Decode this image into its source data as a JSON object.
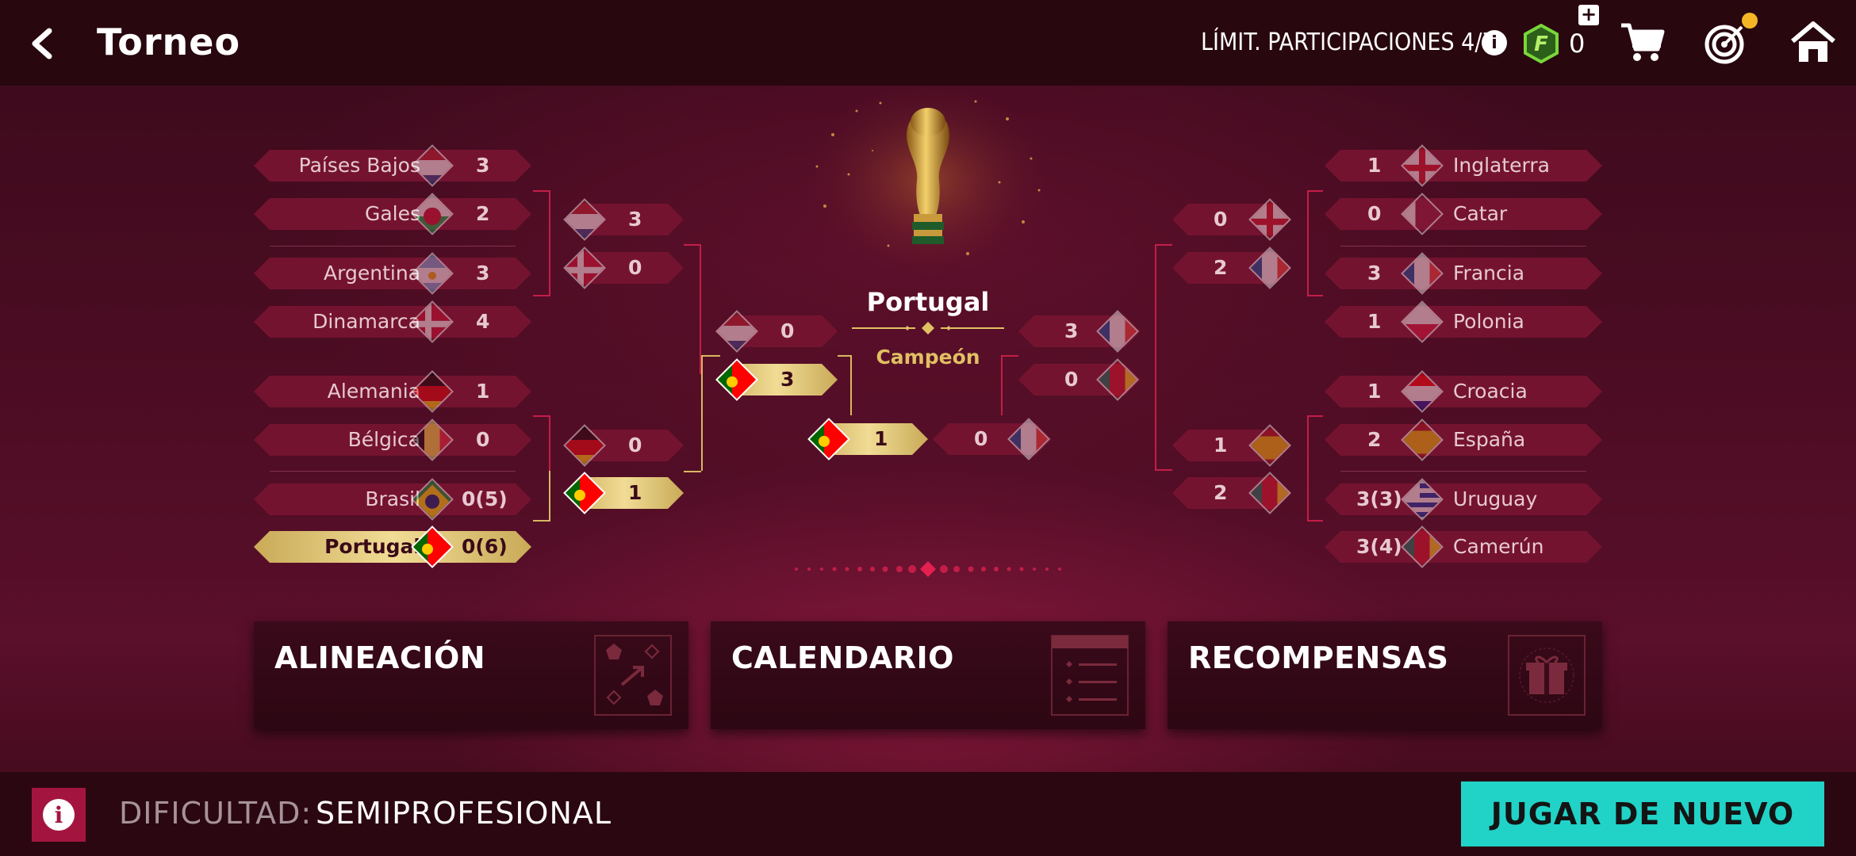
{
  "header": {
    "title": "Torneo",
    "limit_text": "LÍMIT. PARTICIPACIONES 4/7",
    "info": "i",
    "coins": "0",
    "coin_letter": "F",
    "plus": "+"
  },
  "bracket": {
    "left_r16": [
      {
        "team": "Países Bajos",
        "score": "3"
      },
      {
        "team": "Gales",
        "score": "2"
      },
      {
        "team": "Argentina",
        "score": "3"
      },
      {
        "team": "Dinamarca",
        "score": "4"
      },
      {
        "team": "Alemania",
        "score": "1"
      },
      {
        "team": "Bélgica",
        "score": "0"
      },
      {
        "team": "Brasil",
        "score": "0(5)"
      },
      {
        "team": "Portugal",
        "score": "0(6)"
      }
    ],
    "left_qf": [
      "3",
      "0",
      "0",
      "1"
    ],
    "left_sf": [
      "0",
      "3"
    ],
    "final": {
      "left": "1",
      "right": "0"
    },
    "right_sf": [
      "3",
      "0"
    ],
    "right_qf": [
      "0",
      "2",
      "1",
      "2"
    ],
    "right_r16": [
      {
        "team": "Inglaterra",
        "score": "1"
      },
      {
        "team": "Catar",
        "score": "0"
      },
      {
        "team": "Francia",
        "score": "3"
      },
      {
        "team": "Polonia",
        "score": "1"
      },
      {
        "team": "Croacia",
        "score": "1"
      },
      {
        "team": "España",
        "score": "2"
      },
      {
        "team": "Uruguay",
        "score": "3(3)"
      },
      {
        "team": "Camerún",
        "score": "3(4)"
      }
    ]
  },
  "champion": {
    "name": "Portugal",
    "label": "Campeón"
  },
  "cards": [
    {
      "title": "ALINEACIÓN"
    },
    {
      "title": "CALENDARIO"
    },
    {
      "title": "RECOMPENSAS"
    }
  ],
  "footer": {
    "difficulty_label": "DIFICULTAD:",
    "difficulty_value": "SEMIPROFESIONAL",
    "play_again": "JUGAR DE NUEVO"
  },
  "colors": {
    "gold": "#e0c063",
    "teal_button": "#21d3c7",
    "bracket_red": "#c21e48",
    "background": "#4a0c22"
  },
  "icons": [
    "back-arrow-icon",
    "info-icon",
    "fc-coin-icon",
    "plus-icon",
    "cart-icon",
    "target-icon",
    "home-icon"
  ]
}
